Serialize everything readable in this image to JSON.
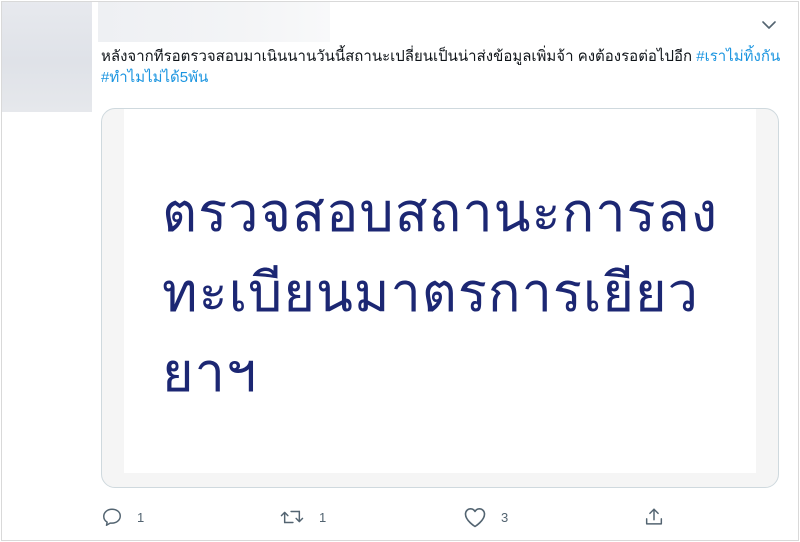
{
  "tweet": {
    "text": "หลังจากทีรอตรวจสอบมาเนินนานวันนี้สถานะเปลี่ยนเป็นน่าส่งข้อมูลเพิ่มจ้า คงต้องรอต่อไปอีก",
    "hashtags": [
      "#เราไม่ทิ้งกัน",
      "#ทำไมไม่ได้5พัน"
    ]
  },
  "media": {
    "title_lines": [
      "ตรวจสอบสถานะการลง",
      "ทะเบียนมาตรการเยียว",
      "ยาฯ"
    ],
    "text_color": "#1c2773"
  },
  "actions": {
    "reply_count": "1",
    "retweet_count": "1",
    "like_count": "3"
  },
  "colors": {
    "hashtag": "#1b95e0",
    "icon": "#536471"
  },
  "icons": [
    "chevron-down-icon",
    "reply-icon",
    "retweet-icon",
    "like-icon",
    "share-icon"
  ]
}
